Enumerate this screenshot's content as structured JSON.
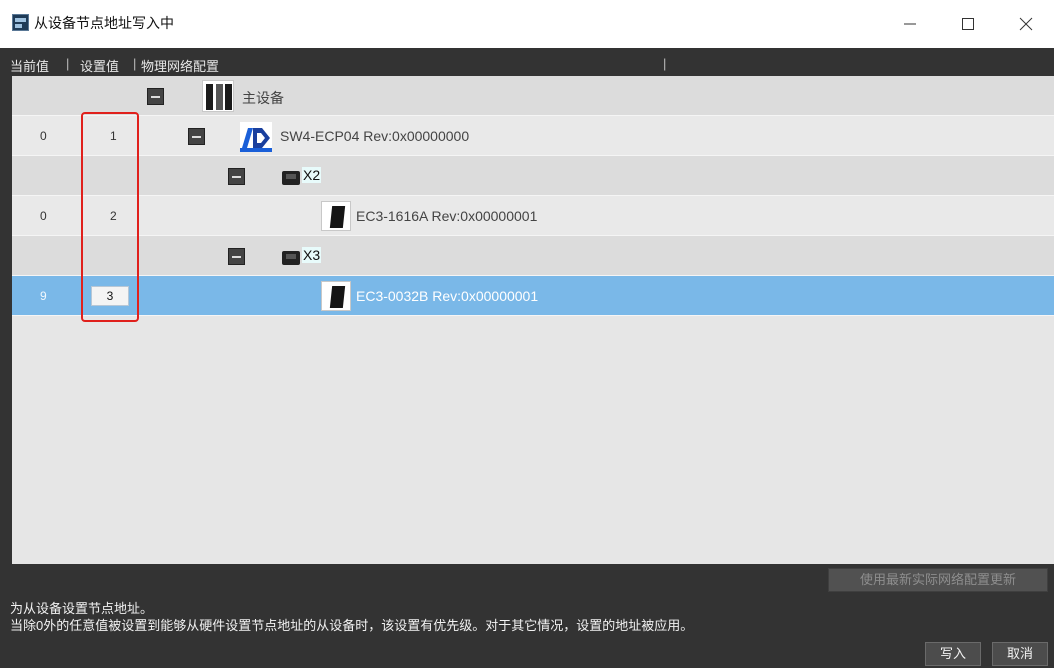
{
  "window": {
    "title": "从设备节点地址写入中",
    "icon": "app-network-icon",
    "controls": {
      "minimize": "—",
      "maximize": "☐",
      "close": "✕"
    }
  },
  "columns": {
    "current": "当前值",
    "setting": "设置值",
    "config": "物理网络配置"
  },
  "tree": {
    "master": "主设备",
    "coupler": {
      "current": "0",
      "setting": "1",
      "label": "SW4-ECP04 Rev:0x00000000"
    },
    "port_x2": "X2",
    "slave1": {
      "current": "0",
      "setting": "2",
      "label": "EC3-1616A Rev:0x00000001"
    },
    "port_x3": "X3",
    "slave2": {
      "current": "9",
      "setting": "3",
      "label": "EC3-0032B Rev:0x00000001"
    }
  },
  "update_button": "使用最新实际网络配置更新",
  "description": {
    "line1": "为从设备设置节点地址。",
    "line2": "当除0外的任意值被设置到能够从硬件设置节点地址的从设备时，该设置有优先级。对于其它情况，设置的地址被应用。"
  },
  "buttons": {
    "write": "写入",
    "cancel": "取消"
  },
  "colors": {
    "selected_row": "#7ab8e8",
    "tree_line": "#f5a623",
    "highlight_box": "#e0201c",
    "panel": "#333333"
  }
}
